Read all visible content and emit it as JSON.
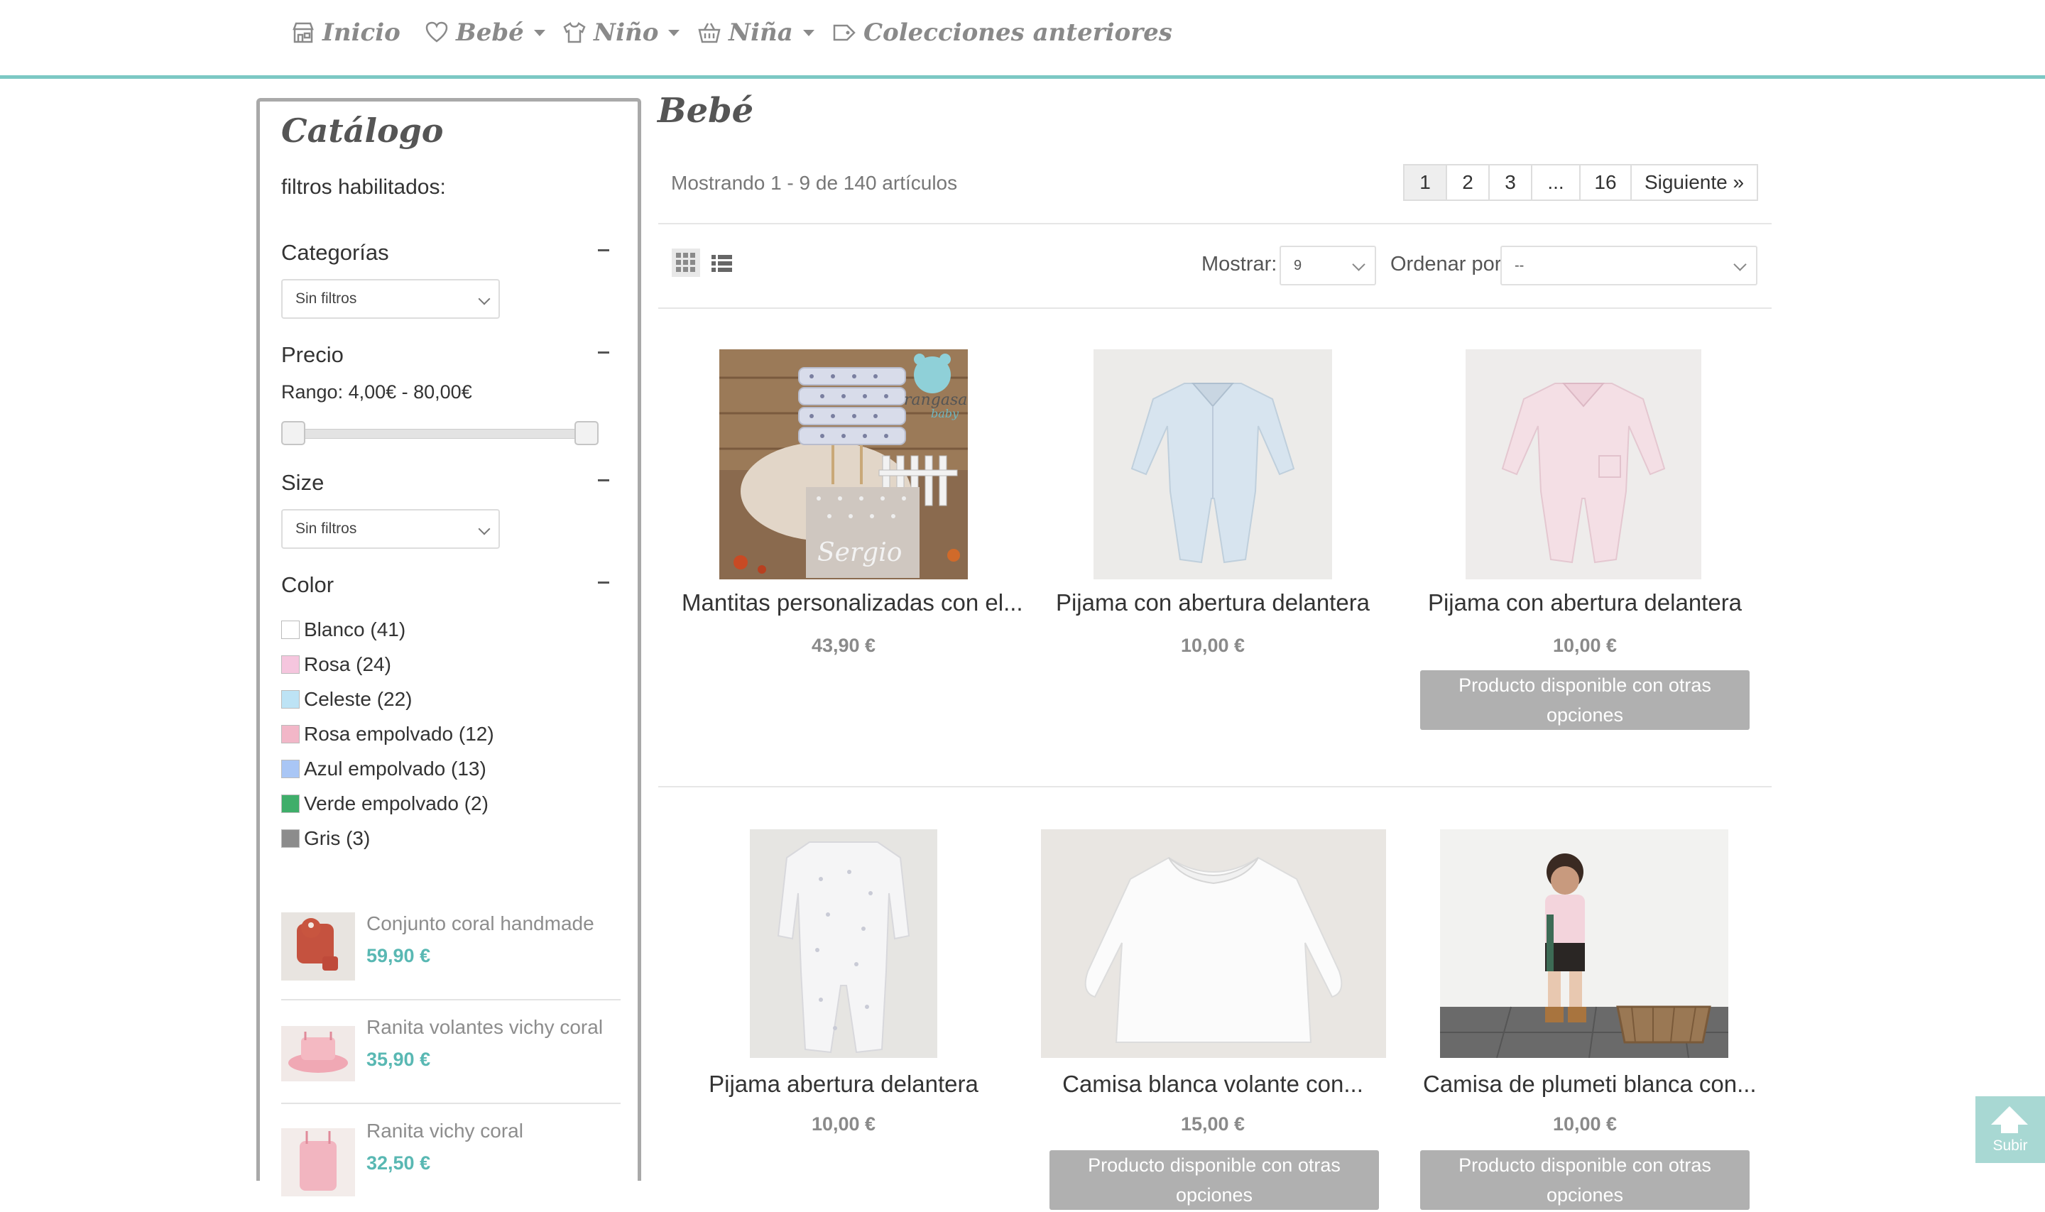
{
  "nav": {
    "items": [
      {
        "label": "Inicio",
        "icon": "shop-icon",
        "dropdown": false
      },
      {
        "label": "Bebé",
        "icon": "heart-icon",
        "dropdown": true
      },
      {
        "label": "Niño",
        "icon": "shirt-icon",
        "dropdown": true
      },
      {
        "label": "Niña",
        "icon": "basket-icon",
        "dropdown": true
      },
      {
        "label": "Colecciones anteriores",
        "icon": "tag-icon",
        "dropdown": false
      }
    ]
  },
  "sidebar": {
    "title": "Catálogo",
    "enabled_filters": "filtros habilitados:",
    "categories": {
      "title": "Categorías",
      "select_value": "Sin filtros"
    },
    "price": {
      "title": "Precio",
      "range_label": "Rango: 4,00€ - 80,00€"
    },
    "size": {
      "title": "Size",
      "select_value": "Sin filtros"
    },
    "color": {
      "title": "Color",
      "items": [
        {
          "label": "Blanco (41)",
          "swatch": "#ffffff"
        },
        {
          "label": "Rosa (24)",
          "swatch": "#f5c6de"
        },
        {
          "label": "Celeste (22)",
          "swatch": "#bde3f5"
        },
        {
          "label": "Rosa empolvado (12)",
          "swatch": "#f2b7c8"
        },
        {
          "label": "Azul empolvado (13)",
          "swatch": "#a9c6f5"
        },
        {
          "label": "Verde empolvado (2)",
          "swatch": "#3fae6a"
        },
        {
          "label": "Gris (3)",
          "swatch": "#8c8c8c"
        }
      ]
    },
    "featured": [
      {
        "name": "Conjunto coral handmade",
        "price": "59,90 €"
      },
      {
        "name": "Ranita volantes vichy coral",
        "price": "35,90 €"
      },
      {
        "name": "Ranita vichy coral",
        "price": "32,50 €"
      }
    ]
  },
  "main": {
    "title": "Bebé",
    "showing": "Mostrando 1 - 9 de 140 artículos",
    "pagination": [
      "1",
      "2",
      "3",
      "...",
      "16",
      "Siguiente »"
    ],
    "show_label": "Mostrar:",
    "show_value": "9",
    "sort_label": "Ordenar por",
    "sort_value": "--",
    "products": [
      {
        "name": "Mantitas personalizadas con el...",
        "price": "43,90 €",
        "available_other": ""
      },
      {
        "name": "Pijama con abertura delantera",
        "price": "10,00 €",
        "available_other": ""
      },
      {
        "name": "Pijama con abertura delantera",
        "price": "10,00 €",
        "available_other": "Producto disponible con otras opciones"
      },
      {
        "name": "Pijama abertura delantera",
        "price": "10,00 €",
        "available_other": ""
      },
      {
        "name": "Camisa blanca volante con...",
        "price": "15,00 €",
        "available_other": "Producto disponible con otras opciones"
      },
      {
        "name": "Camisa de plumeti blanca con...",
        "price": "10,00 €",
        "available_other": "Producto disponible con otras opciones"
      }
    ],
    "image_texts": {
      "brand": "rangasa",
      "brand_sub": "baby",
      "name": "Sergio"
    }
  },
  "back_to_top": "Subir",
  "colors": {
    "accent": "#7cc8c4",
    "featured_price": "#59b8b3",
    "button_gray": "#b0b0b0"
  }
}
